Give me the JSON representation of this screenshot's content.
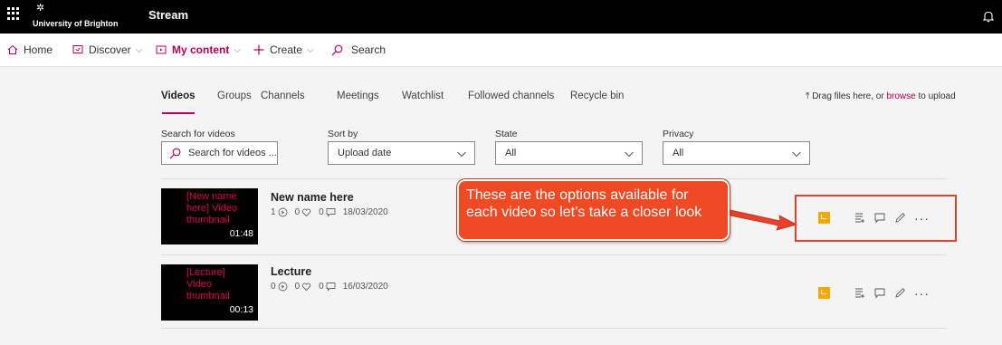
{
  "topbar": {
    "org_name": "University of Brighton",
    "app_name": "Stream"
  },
  "nav": {
    "home": "Home",
    "discover": "Discover",
    "my_content": "My content",
    "create": "Create",
    "search": "Search"
  },
  "tabs": [
    "Videos",
    "Groups",
    "Channels",
    "Meetings",
    "Watchlist",
    "Followed channels",
    "Recycle bin"
  ],
  "upload": {
    "prefix": "Drag files here, or",
    "link": "browse",
    "suffix": "to upload"
  },
  "filters": {
    "search_label": "Search for videos",
    "search_placeholder": "Search for videos ...",
    "sort_label": "Sort by",
    "sort_value": "Upload date",
    "state_label": "State",
    "state_value": "All",
    "privacy_label": "Privacy",
    "privacy_value": "All"
  },
  "videos": [
    {
      "thumb_text": "[New name here] Video thumbnail",
      "duration": "01:48",
      "title": "New name here",
      "views": "1",
      "likes": "0",
      "comments": "0",
      "date": "18/03/2020"
    },
    {
      "thumb_text": "[Lecture] Video thumbnail",
      "duration": "00:13",
      "title": "Lecture",
      "views": "0",
      "likes": "0",
      "comments": "0",
      "date": "16/03/2020"
    }
  ],
  "annotation": {
    "text": "These are the options available for each video so let’s take a closer look"
  },
  "colors": {
    "accent": "#b4005a",
    "annotation": "#ef4a23",
    "badge": "#f2a900"
  }
}
